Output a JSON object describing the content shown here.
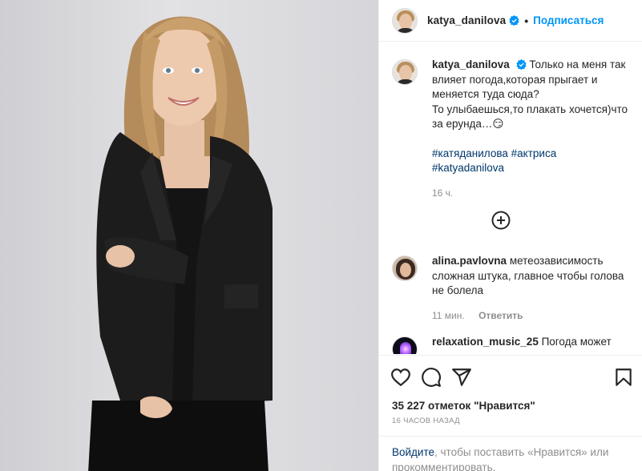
{
  "header": {
    "username": "katya_danilova",
    "separator": "•",
    "follow_label": "Подписаться"
  },
  "caption": {
    "username": "katya_danilova",
    "text": "Только на меня так влияет погода,которая прыгает и меняется туда сюда?",
    "line2": "То улыбаешься,то плакать хочется)что за ерунда…😏",
    "hashtags": [
      "#катяданилова",
      "#актриса",
      "#katyadanilova"
    ],
    "time": "16 ч."
  },
  "load_more_icon": "plus-circle-icon",
  "comments": [
    {
      "username": "alina.pavlovna",
      "text": "метеозависимость сложная штука, главное чтобы голова не болела",
      "time": "11 мин.",
      "reply_label": "Ответить"
    },
    {
      "username": "relaxation_music_25",
      "text": "Погода может"
    }
  ],
  "actions": {
    "icons": [
      "heart-icon",
      "comment-icon",
      "share-icon",
      "bookmark-icon"
    ],
    "likes": "35 227 отметок \"Нравится\"",
    "time": "16 ЧАСОВ НАЗАД",
    "login_link": "Войдите",
    "login_text": ", чтобы поставить «Нравится» или прокомментировать."
  },
  "colors": {
    "accent": "#0095f6",
    "link": "#00376b",
    "muted": "#8e8e8e",
    "verified": "#0095f6"
  }
}
